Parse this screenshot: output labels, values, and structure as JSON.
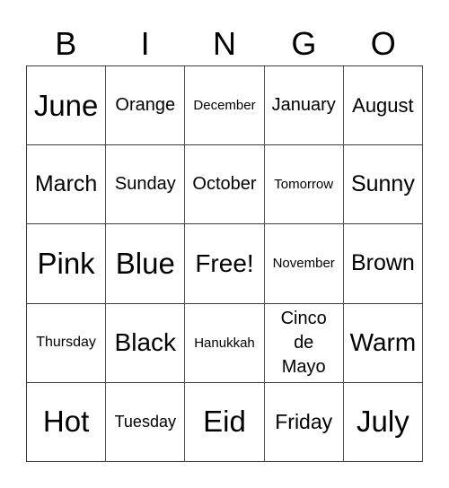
{
  "card": {
    "header": [
      "B",
      "I",
      "N",
      "G",
      "O"
    ],
    "rows": [
      [
        "June",
        "Orange",
        "December",
        "January",
        "August"
      ],
      [
        "March",
        "Sunday",
        "October",
        "Tomorrow",
        "Sunny"
      ],
      [
        "Pink",
        "Blue",
        "Free!",
        "November",
        "Brown"
      ],
      [
        "Thursday",
        "Black",
        "Hanukkah",
        "Cinco de Mayo",
        "Warm"
      ],
      [
        "Hot",
        "Tuesday",
        "Eid",
        "Friday",
        "July"
      ]
    ],
    "free_space_label": "Free!"
  }
}
